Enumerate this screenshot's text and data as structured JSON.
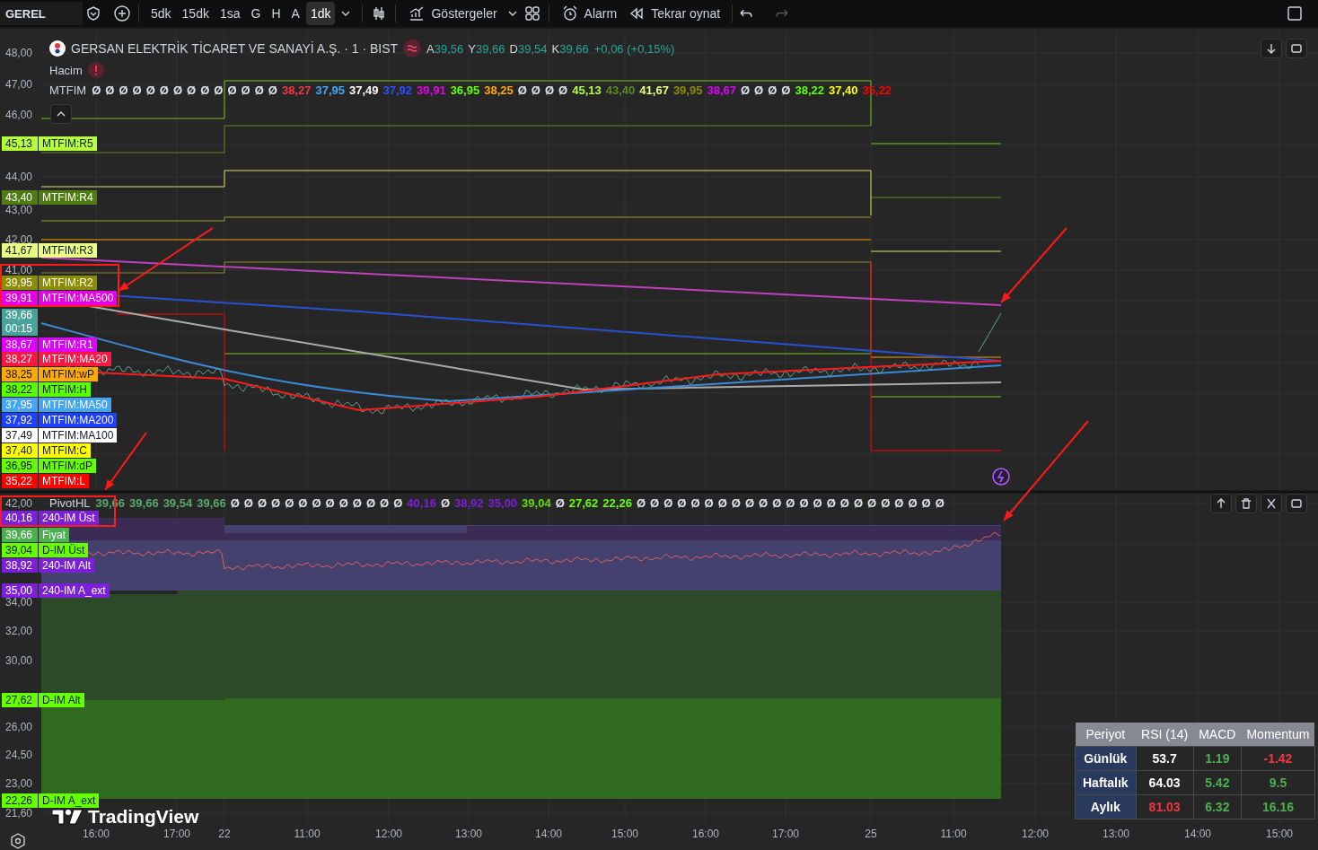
{
  "toolbar": {
    "symbol": "GEREL",
    "intervals": [
      {
        "label": "5dk",
        "selected": false
      },
      {
        "label": "15dk",
        "selected": false
      },
      {
        "label": "1sa",
        "selected": false
      },
      {
        "label": "G",
        "selected": false
      },
      {
        "label": "H",
        "selected": false
      },
      {
        "label": "A",
        "selected": false
      },
      {
        "label": "1dk",
        "selected": true
      }
    ],
    "indicators": "Göstergeler",
    "alert": "Alarm",
    "replay": "Tekrar oynat"
  },
  "legend": {
    "title": "GERSAN ELEKTRİK TİCARET VE SANAYİ A.Ş. · 1 · BIST",
    "ohlc": [
      {
        "key": "A",
        "value": "39,56"
      },
      {
        "key": "Y",
        "value": "39,66"
      },
      {
        "key": "D",
        "value": "39,54"
      },
      {
        "key": "K",
        "value": "39,66"
      }
    ],
    "change": "+0,06 (+0,15%)",
    "volume": "Hacim",
    "mtfim": {
      "name": "MTFIM",
      "values": [
        {
          "text": "Ø",
          "color": "#e0e3eb"
        },
        {
          "text": "Ø",
          "color": "#e0e3eb"
        },
        {
          "text": "Ø",
          "color": "#e0e3eb"
        },
        {
          "text": "Ø",
          "color": "#e0e3eb"
        },
        {
          "text": "Ø",
          "color": "#e0e3eb"
        },
        {
          "text": "Ø",
          "color": "#e0e3eb"
        },
        {
          "text": "Ø",
          "color": "#e0e3eb"
        },
        {
          "text": "Ø",
          "color": "#e0e3eb"
        },
        {
          "text": "Ø",
          "color": "#e0e3eb"
        },
        {
          "text": "Ø",
          "color": "#e0e3eb"
        },
        {
          "text": "Ø",
          "color": "#e0e3eb"
        },
        {
          "text": "Ø",
          "color": "#e0e3eb"
        },
        {
          "text": "Ø",
          "color": "#e0e3eb"
        },
        {
          "text": "Ø",
          "color": "#e0e3eb"
        },
        {
          "text": "38,27",
          "color": "#f23645"
        },
        {
          "text": "37,95",
          "color": "#42a5f5"
        },
        {
          "text": "37,49",
          "color": "#ffffff"
        },
        {
          "text": "37,92",
          "color": "#3050ff"
        },
        {
          "text": "39,91",
          "color": "#e600e6"
        },
        {
          "text": "36,95",
          "color": "#66ff00"
        },
        {
          "text": "38,25",
          "color": "#ffaa00"
        },
        {
          "text": "Ø",
          "color": "#e0e3eb"
        },
        {
          "text": "Ø",
          "color": "#e0e3eb"
        },
        {
          "text": "Ø",
          "color": "#e0e3eb"
        },
        {
          "text": "Ø",
          "color": "#e0e3eb"
        },
        {
          "text": "45,13",
          "color": "#b5ff3b"
        },
        {
          "text": "43,40",
          "color": "#5e8c1a"
        },
        {
          "text": "41,67",
          "color": "#e8ff80"
        },
        {
          "text": "39,95",
          "color": "#8c8c00"
        },
        {
          "text": "38,67",
          "color": "#dd00ff"
        },
        {
          "text": "Ø",
          "color": "#e0e3eb"
        },
        {
          "text": "Ø",
          "color": "#e0e3eb"
        },
        {
          "text": "Ø",
          "color": "#e0e3eb"
        },
        {
          "text": "Ø",
          "color": "#e0e3eb"
        },
        {
          "text": "38,22",
          "color": "#5cff00"
        },
        {
          "text": "37,40",
          "color": "#ffff00"
        },
        {
          "text": "35,22",
          "color": "#ff0000"
        }
      ]
    }
  },
  "main_axis": {
    "ticks": [
      "48,00",
      "47,00",
      "46,00",
      "44,00",
      "43,00",
      "42,00",
      "41,00"
    ],
    "labels": [
      {
        "kind": "line",
        "value": "45,13",
        "name": "MTFIM:R5",
        "color": "#b5ff3b"
      },
      {
        "kind": "line",
        "value": "43,40",
        "name": "MTFIM:R4",
        "color": "#4f7c12"
      },
      {
        "kind": "line",
        "value": "41,67",
        "name": "MTFIM:R3",
        "color": "#e8ff80"
      },
      {
        "kind": "line",
        "value": "39,95",
        "name": "MTFIM:R2",
        "color": "#8c8c00"
      },
      {
        "kind": "line",
        "value": "39,91",
        "name": "MTFIM:MA500",
        "color": "#e600e6"
      },
      {
        "kind": "countdown",
        "value": "39,66",
        "name": "00:15",
        "color": "#4aa39b"
      },
      {
        "kind": "line",
        "value": "38,67",
        "name": "MTFIM:R1",
        "color": "#dd00ff"
      },
      {
        "kind": "line",
        "value": "38,27",
        "name": "MTFIM:MA20",
        "color": "#ff1744"
      },
      {
        "kind": "line",
        "value": "38,25",
        "name": "MTFIM:wP",
        "color": "#ffaa00"
      },
      {
        "kind": "line",
        "value": "38,22",
        "name": "MTFIM:H",
        "color": "#5cff00"
      },
      {
        "kind": "line",
        "value": "37,95",
        "name": "MTFIM:MA50",
        "color": "#42a5f5"
      },
      {
        "kind": "line",
        "value": "37,92",
        "name": "MTFIM:MA200",
        "color": "#2040ff"
      },
      {
        "kind": "line",
        "value": "37,49",
        "name": "MTFIM:MA100",
        "color": "#ffffff"
      },
      {
        "kind": "line",
        "value": "37,40",
        "name": "MTFIM:C",
        "color": "#ffff00"
      },
      {
        "kind": "line",
        "value": "36,95",
        "name": "MTFIM:dP",
        "color": "#66ff00"
      },
      {
        "kind": "line",
        "value": "35,22",
        "name": "MTFIM:L",
        "color": "#ff0000"
      }
    ]
  },
  "pivot": {
    "name": "PivotHL",
    "values": [
      {
        "text": "39,66",
        "color": "#5aa86a"
      },
      {
        "text": "39,66",
        "color": "#5aa86a"
      },
      {
        "text": "39,54",
        "color": "#5aa86a"
      },
      {
        "text": "39,66",
        "color": "#5aa86a"
      },
      {
        "text": "Ø",
        "color": "#e0e3eb"
      },
      {
        "text": "Ø",
        "color": "#e0e3eb"
      },
      {
        "text": "Ø",
        "color": "#e0e3eb"
      },
      {
        "text": "Ø",
        "color": "#e0e3eb"
      },
      {
        "text": "Ø",
        "color": "#e0e3eb"
      },
      {
        "text": "Ø",
        "color": "#e0e3eb"
      },
      {
        "text": "Ø",
        "color": "#e0e3eb"
      },
      {
        "text": "Ø",
        "color": "#e0e3eb"
      },
      {
        "text": "Ø",
        "color": "#e0e3eb"
      },
      {
        "text": "Ø",
        "color": "#e0e3eb"
      },
      {
        "text": "Ø",
        "color": "#e0e3eb"
      },
      {
        "text": "Ø",
        "color": "#e0e3eb"
      },
      {
        "text": "Ø",
        "color": "#e0e3eb"
      },
      {
        "text": "40,16",
        "color": "#7c1fd9"
      },
      {
        "text": "Ø",
        "color": "#e0e3eb"
      },
      {
        "text": "38,92",
        "color": "#7c1fd9"
      },
      {
        "text": "35,00",
        "color": "#7c1fd9"
      },
      {
        "text": "39,04",
        "color": "#66dd00"
      },
      {
        "text": "Ø",
        "color": "#e0e3eb"
      },
      {
        "text": "27,62",
        "color": "#66ff00"
      },
      {
        "text": "22,26",
        "color": "#66ff00"
      },
      {
        "text": "Ø",
        "color": "#e0e3eb"
      },
      {
        "text": "Ø",
        "color": "#e0e3eb"
      },
      {
        "text": "Ø",
        "color": "#e0e3eb"
      },
      {
        "text": "Ø",
        "color": "#e0e3eb"
      },
      {
        "text": "Ø",
        "color": "#e0e3eb"
      },
      {
        "text": "Ø",
        "color": "#e0e3eb"
      },
      {
        "text": "Ø",
        "color": "#e0e3eb"
      },
      {
        "text": "Ø",
        "color": "#e0e3eb"
      },
      {
        "text": "Ø",
        "color": "#e0e3eb"
      },
      {
        "text": "Ø",
        "color": "#e0e3eb"
      },
      {
        "text": "Ø",
        "color": "#e0e3eb"
      },
      {
        "text": "Ø",
        "color": "#e0e3eb"
      },
      {
        "text": "Ø",
        "color": "#e0e3eb"
      },
      {
        "text": "Ø",
        "color": "#e0e3eb"
      },
      {
        "text": "Ø",
        "color": "#e0e3eb"
      },
      {
        "text": "Ø",
        "color": "#e0e3eb"
      },
      {
        "text": "Ø",
        "color": "#e0e3eb"
      },
      {
        "text": "Ø",
        "color": "#e0e3eb"
      },
      {
        "text": "Ø",
        "color": "#e0e3eb"
      },
      {
        "text": "Ø",
        "color": "#e0e3eb"
      },
      {
        "text": "Ø",
        "color": "#e0e3eb"
      },
      {
        "text": "Ø",
        "color": "#e0e3eb"
      },
      {
        "text": "Ø",
        "color": "#e0e3eb"
      }
    ]
  },
  "lower_axis": {
    "ticks": [
      "42,00",
      "34,00",
      "32,00",
      "30,00",
      "26,00",
      "24,50",
      "23,00",
      "21,60"
    ],
    "labels": [
      {
        "kind": "line",
        "value": "40,16",
        "name": "240-IM Üst",
        "color": "#7c1fd9"
      },
      {
        "kind": "line",
        "value": "39,66",
        "name": "Fiyat",
        "color": "#4caf50"
      },
      {
        "kind": "line",
        "value": "39,04",
        "name": "D-IM Üst",
        "color": "#66ff00"
      },
      {
        "kind": "line",
        "value": "38,92",
        "name": "240-IM Alt",
        "color": "#7c1fd9"
      },
      {
        "kind": "line",
        "value": "35,00",
        "name": "240-IM A_ext",
        "color": "#7c1fd9"
      },
      {
        "kind": "line",
        "value": "27,62",
        "name": "D-IM Alt",
        "color": "#66ff00"
      },
      {
        "kind": "line",
        "value": "22,26",
        "name": "D-IM A_ext",
        "color": "#66ff00"
      }
    ]
  },
  "table": {
    "columns": [
      "Periyot",
      "RSI (14)",
      "MACD",
      "Momentum"
    ],
    "rows": [
      {
        "cells": [
          {
            "text": "Günlük"
          },
          {
            "text": "53.7"
          },
          {
            "text": "1.19",
            "color": "#4caf50"
          },
          {
            "text": "-1.42",
            "color": "#f23645"
          }
        ]
      },
      {
        "cells": [
          {
            "text": "Haftalık"
          },
          {
            "text": "64.03"
          },
          {
            "text": "5.42",
            "color": "#4caf50"
          },
          {
            "text": "9.5",
            "color": "#4caf50"
          }
        ]
      },
      {
        "cells": [
          {
            "text": "Aylık"
          },
          {
            "text": "81.03",
            "color": "#f23645"
          },
          {
            "text": "6.32",
            "color": "#4caf50"
          },
          {
            "text": "16.16",
            "color": "#4caf50"
          }
        ]
      }
    ]
  },
  "brand": "TradingView",
  "time_axis": [
    "16:00",
    "17:00",
    "22",
    "11:00",
    "12:00",
    "13:00",
    "14:00",
    "15:00",
    "16:00",
    "17:00",
    "25",
    "11:00",
    "12:00",
    "13:00",
    "14:00",
    "15:00"
  ]
}
